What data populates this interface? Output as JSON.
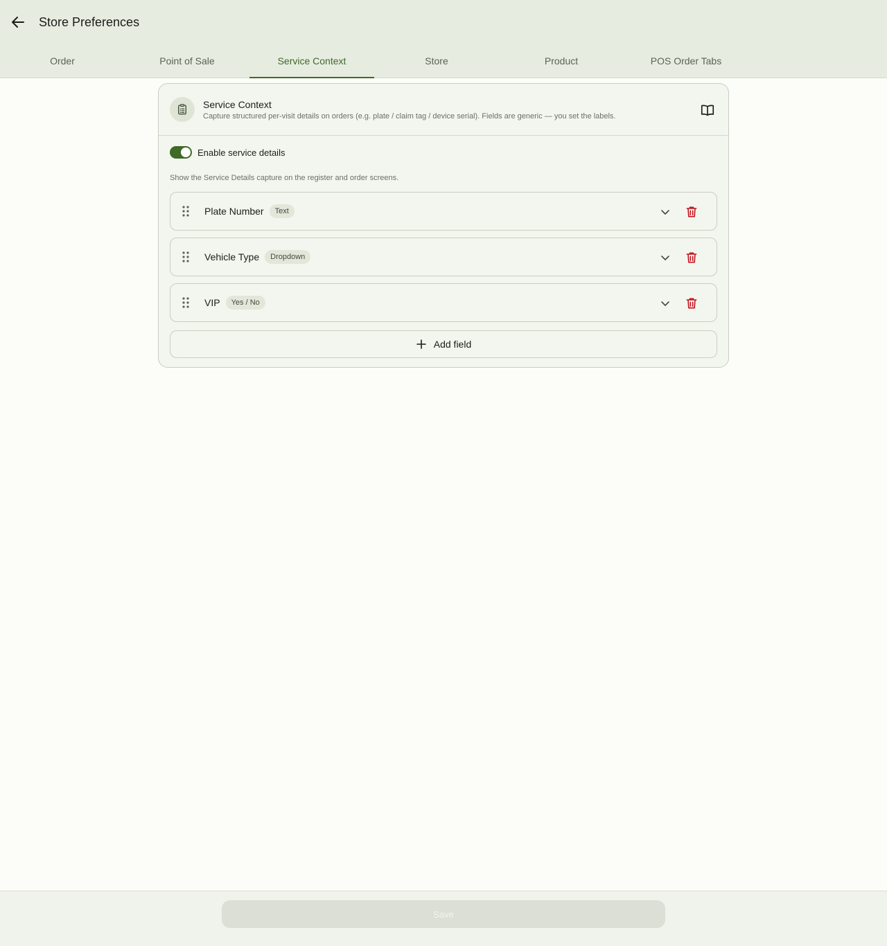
{
  "header": {
    "title": "Store Preferences",
    "back_icon": "arrow-left-icon"
  },
  "tabs": [
    {
      "label": "Order",
      "active": false
    },
    {
      "label": "Point of Sale",
      "active": false
    },
    {
      "label": "Service Context",
      "active": true
    },
    {
      "label": "Store",
      "active": false
    },
    {
      "label": "Product",
      "active": false
    },
    {
      "label": "POS Order Tabs",
      "active": false
    }
  ],
  "card": {
    "title": "Service Context",
    "description": "Capture structured per-visit details on orders (e.g. plate / claim tag / device serial). Fields are generic — you set the labels.",
    "icon": "clipboard-icon",
    "help_icon": "book-icon"
  },
  "toggle": {
    "label": "Enable service details",
    "enabled": true
  },
  "helper_text": "Show the Service Details capture on the register and order screens.",
  "fields": [
    {
      "name": "Plate Number",
      "type": "Text"
    },
    {
      "name": "Vehicle Type",
      "type": "Dropdown"
    },
    {
      "name": "VIP",
      "type": "Yes / No"
    }
  ],
  "add_field_label": "Add field",
  "footer": {
    "save_label": "Save",
    "save_enabled": false
  },
  "colors": {
    "accent": "#3f6a27",
    "danger": "#c1121f",
    "appbar": "#e7ece0"
  }
}
